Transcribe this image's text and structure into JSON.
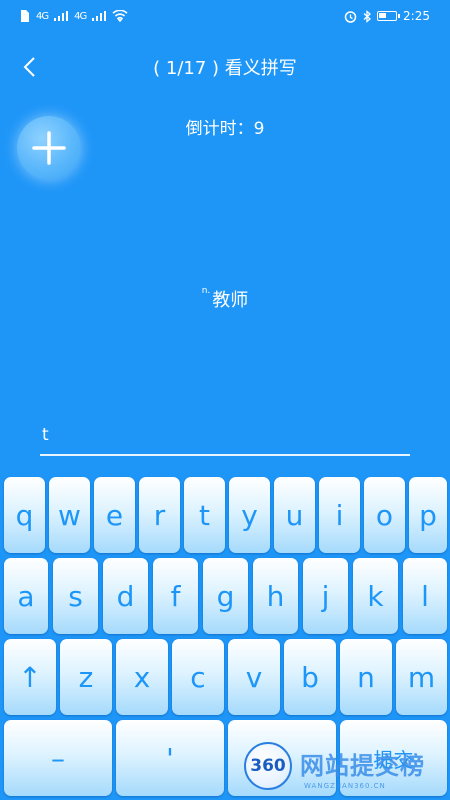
{
  "status_bar": {
    "signal_1": "4G",
    "signal_2": "4G",
    "time": "2:25",
    "icons": [
      "sim-icon",
      "signal-icon",
      "wifi-icon",
      "alarm-icon",
      "bluetooth-icon",
      "battery-icon"
    ]
  },
  "header": {
    "title": "( 1/17 ) 看义拼写"
  },
  "countdown": {
    "text": "倒计时：9"
  },
  "question": {
    "pos": "n.",
    "meaning": "教师"
  },
  "answer": {
    "value": "t"
  },
  "keyboard": {
    "row1": [
      "q",
      "w",
      "e",
      "r",
      "t",
      "y",
      "u",
      "i",
      "o",
      "p"
    ],
    "row2": [
      "a",
      "s",
      "d",
      "f",
      "g",
      "h",
      "j",
      "k",
      "l"
    ],
    "row3": [
      "↑",
      "z",
      "x",
      "c",
      "v",
      "b",
      "n",
      "m"
    ],
    "row4": [
      "–",
      "'"
    ],
    "submit_hint": "提交"
  },
  "watermark": {
    "badge": "360",
    "text": "网站提交榜",
    "sub": "WANGZHAN360.CN"
  },
  "colors": {
    "background": "#1e96f8",
    "key_text": "#1e96f8"
  }
}
